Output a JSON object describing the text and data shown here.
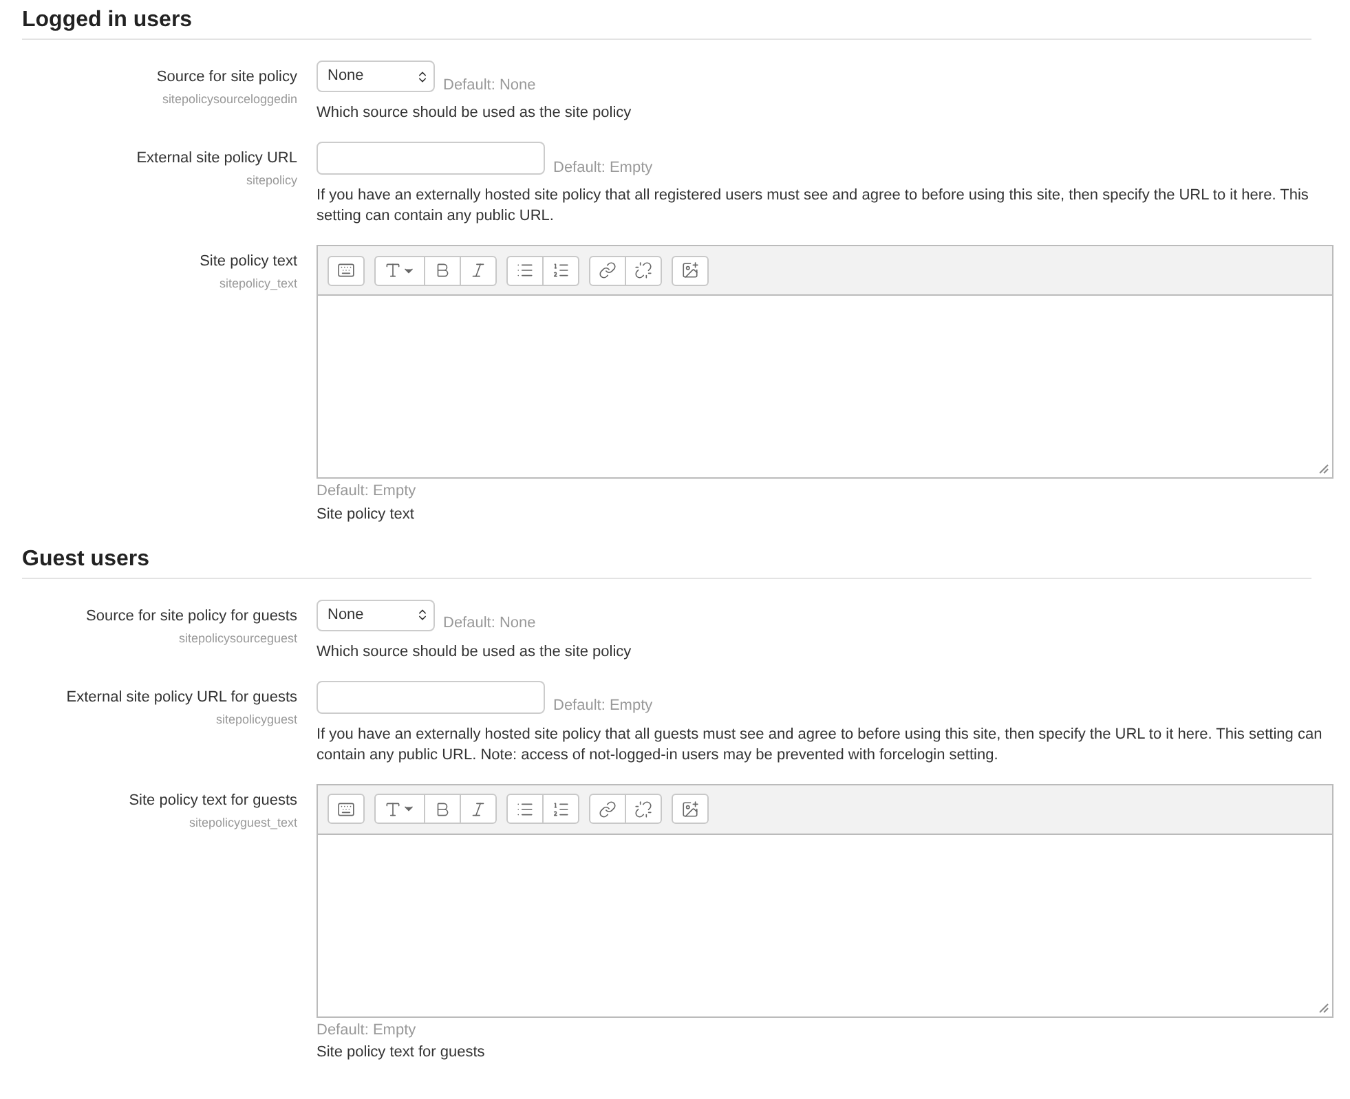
{
  "sections": [
    {
      "heading": "Logged in users",
      "settings": [
        {
          "kind": "select",
          "label": "Source for site policy",
          "name": "sitepolicysourceloggedin",
          "value": "None",
          "default": "Default: None",
          "description": "Which source should be used as the site policy"
        },
        {
          "kind": "text",
          "label": "External site policy URL",
          "name": "sitepolicy",
          "default": "Default: Empty",
          "description": "If you have an externally hosted site policy that all registered users must see and agree to before using this site, then specify the URL to it here. This setting can contain any public URL."
        },
        {
          "kind": "editor",
          "label": "Site policy text",
          "name": "sitepolicy_text",
          "default": "Default: Empty",
          "description": "Site policy text"
        }
      ]
    },
    {
      "heading": "Guest users",
      "settings": [
        {
          "kind": "select",
          "label": "Source for site policy for guests",
          "name": "sitepolicysourceguest",
          "value": "None",
          "default": "Default: None",
          "description": "Which source should be used as the site policy"
        },
        {
          "kind": "text",
          "label": "External site policy URL for guests",
          "name": "sitepolicyguest",
          "default": "Default: Empty",
          "description": "If you have an externally hosted site policy that all guests must see and agree to before using this site, then specify the URL to it here. This setting can contain any public URL. Note: access of not-logged-in users may be prevented with forcelogin setting."
        },
        {
          "kind": "editor",
          "label": "Site policy text for guests",
          "name": "sitepolicyguest_text",
          "default": "Default: Empty",
          "description": "Site policy text for guests"
        }
      ]
    }
  ]
}
